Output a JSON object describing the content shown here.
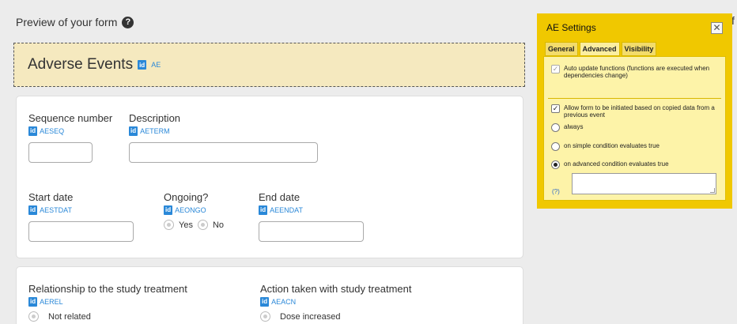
{
  "preview": {
    "label": "Preview of your form",
    "help_icon": "?"
  },
  "edge_text": "f",
  "form": {
    "title": "Adverse Events",
    "id_badge": "id",
    "code": "AE"
  },
  "fields": {
    "seq": {
      "label": "Sequence number",
      "code": "AESEQ"
    },
    "desc": {
      "label": "Description",
      "code": "AETERM"
    },
    "start": {
      "label": "Start date",
      "code": "AESTDAT"
    },
    "ongoing": {
      "label": "Ongoing?",
      "code": "AEONGO",
      "yes": "Yes",
      "no": "No"
    },
    "end": {
      "label": "End date",
      "code": "AEENDAT"
    },
    "rel": {
      "label": "Relationship to the study treatment",
      "code": "AEREL",
      "option1": "Not related"
    },
    "action": {
      "label": "Action taken with study treatment",
      "code": "AEACN",
      "option1": "Dose increased"
    }
  },
  "panel": {
    "title": "AE Settings",
    "close": "✕",
    "tabs": [
      "General",
      "Advanced",
      "Visibility"
    ],
    "auto_update": "Auto update functions (functions are executed when dependencies change)",
    "allow_init": "Allow form to be initiated based on copied data from a previous event",
    "opt_always": "always",
    "opt_simple": "on simple condition evaluates true",
    "opt_advanced": "on advanced condition evaluates true",
    "help": "(?)"
  }
}
